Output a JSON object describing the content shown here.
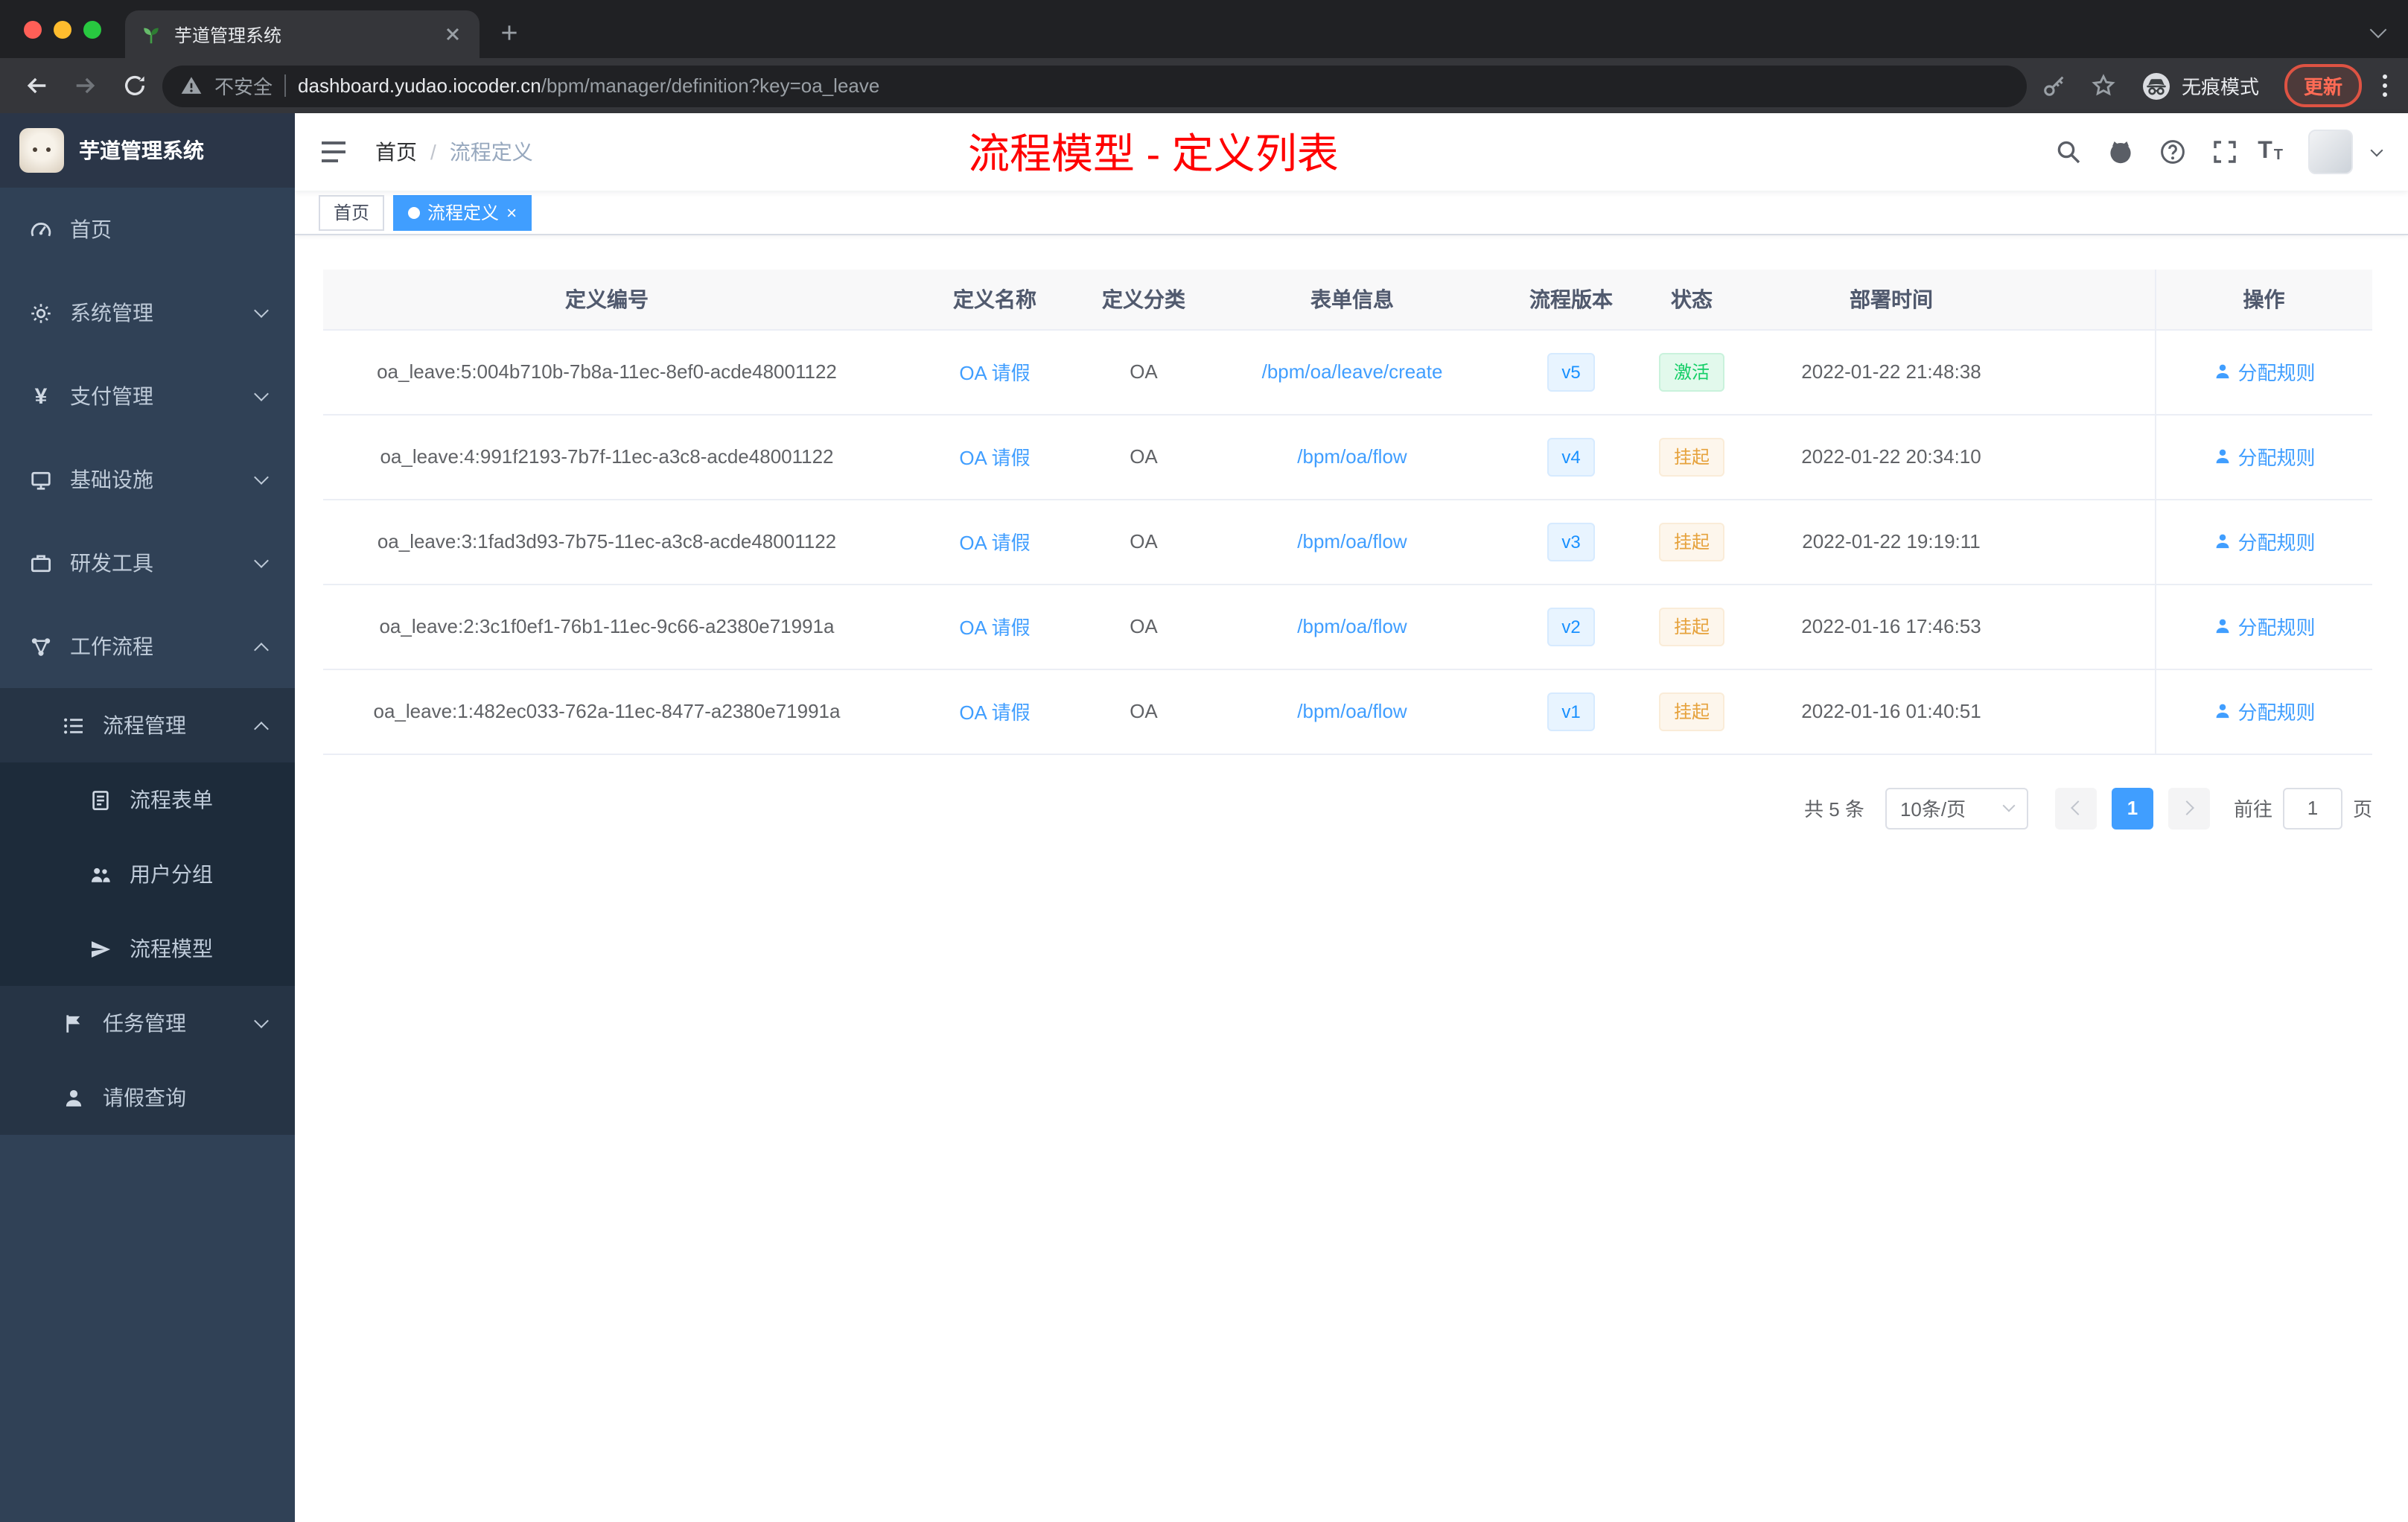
{
  "browser": {
    "tab_title": "芋道管理系统",
    "security_label": "不安全",
    "url_domain": "dashboard.yudao.iocoder.cn",
    "url_path": "/bpm/manager/definition?key=oa_leave",
    "incognito_label": "无痕模式",
    "update_label": "更新"
  },
  "sidebar": {
    "logo_title": "芋道管理系统",
    "items": {
      "home": "首页",
      "system": "系统管理",
      "payment": "支付管理",
      "infra": "基础设施",
      "devtools": "研发工具",
      "workflow": "工作流程",
      "process_mgmt": "流程管理",
      "process_form": "流程表单",
      "user_group": "用户分组",
      "process_model": "流程模型",
      "task_mgmt": "任务管理",
      "leave_query": "请假查询"
    }
  },
  "header": {
    "breadcrumb_home": "首页",
    "breadcrumb_sep": "/",
    "breadcrumb_current": "流程定义",
    "overlay_title": "流程模型 - 定义列表"
  },
  "tags": {
    "home": "首页",
    "active": "流程定义",
    "close": "×"
  },
  "table": {
    "columns": {
      "id": "定义编号",
      "name": "定义名称",
      "category": "定义分类",
      "form": "表单信息",
      "version": "流程版本",
      "status": "状态",
      "deploy_time": "部署时间",
      "operation": "操作"
    },
    "rows": [
      {
        "id": "oa_leave:5:004b710b-7b8a-11ec-8ef0-acde48001122",
        "name": "OA 请假",
        "category": "OA",
        "form": "/bpm/oa/leave/create",
        "version": "v5",
        "status": "激活",
        "status_type": "success",
        "time": "2022-01-22 21:48:38",
        "action": "分配规则"
      },
      {
        "id": "oa_leave:4:991f2193-7b7f-11ec-a3c8-acde48001122",
        "name": "OA 请假",
        "category": "OA",
        "form": "/bpm/oa/flow",
        "version": "v4",
        "status": "挂起",
        "status_type": "warning",
        "time": "2022-01-22 20:34:10",
        "action": "分配规则"
      },
      {
        "id": "oa_leave:3:1fad3d93-7b75-11ec-a3c8-acde48001122",
        "name": "OA 请假",
        "category": "OA",
        "form": "/bpm/oa/flow",
        "version": "v3",
        "status": "挂起",
        "status_type": "warning",
        "time": "2022-01-22 19:19:11",
        "action": "分配规则"
      },
      {
        "id": "oa_leave:2:3c1f0ef1-76b1-11ec-9c66-a2380e71991a",
        "name": "OA 请假",
        "category": "OA",
        "form": "/bpm/oa/flow",
        "version": "v2",
        "status": "挂起",
        "status_type": "warning",
        "time": "2022-01-16 17:46:53",
        "action": "分配规则"
      },
      {
        "id": "oa_leave:1:482ec033-762a-11ec-8477-a2380e71991a",
        "name": "OA 请假",
        "category": "OA",
        "form": "/bpm/oa/flow",
        "version": "v1",
        "status": "挂起",
        "status_type": "warning",
        "time": "2022-01-16 01:40:51",
        "action": "分配规则"
      }
    ]
  },
  "pagination": {
    "total": "共 5 条",
    "page_size": "10条/页",
    "page": "1",
    "goto_label": "前往",
    "goto_value": "1",
    "page_unit": "页"
  }
}
